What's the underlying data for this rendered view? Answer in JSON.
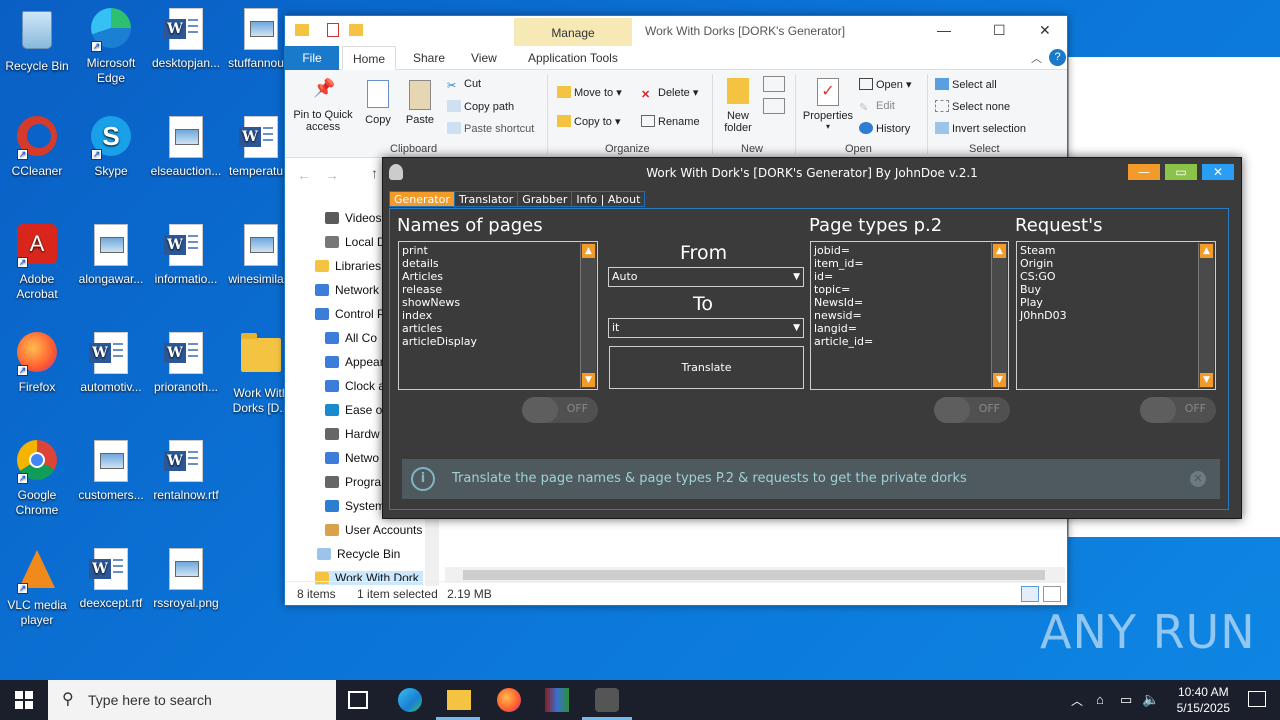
{
  "desktop": {
    "icons": [
      {
        "label": "Recycle Bin",
        "type": "recycle"
      },
      {
        "label": "Microsoft Edge",
        "type": "edge"
      },
      {
        "label": "desktopjan...",
        "type": "word"
      },
      {
        "label": "stuffannou...",
        "type": "image"
      },
      {
        "label": "CCleaner",
        "type": "ccleaner"
      },
      {
        "label": "Skype",
        "type": "skype"
      },
      {
        "label": "elseauction...",
        "type": "image"
      },
      {
        "label": "temperatu...",
        "type": "word"
      },
      {
        "label": "Adobe Acrobat",
        "type": "acrobat"
      },
      {
        "label": "alongawar...",
        "type": "image"
      },
      {
        "label": "informatio...",
        "type": "word"
      },
      {
        "label": "winesimila...",
        "type": "image"
      },
      {
        "label": "Firefox",
        "type": "firefox"
      },
      {
        "label": "automotiv...",
        "type": "word"
      },
      {
        "label": "prioranoth...",
        "type": "word"
      },
      {
        "label": "Work With Dorks [D...",
        "type": "folder"
      },
      {
        "label": "Google Chrome",
        "type": "chrome"
      },
      {
        "label": "customers...",
        "type": "image"
      },
      {
        "label": "rentalnow.rtf",
        "type": "word"
      },
      {
        "label": "VLC media player",
        "type": "vlc"
      },
      {
        "label": "deexcept.rtf",
        "type": "word"
      },
      {
        "label": "rssroyal.png",
        "type": "image"
      }
    ]
  },
  "explorer": {
    "manage_label": "Manage",
    "title": "Work With Dorks [DORK's Generator]",
    "tabs": {
      "file": "File",
      "home": "Home",
      "share": "Share",
      "view": "View",
      "app_tools": "Application Tools"
    },
    "ribbon": {
      "pin": "Pin to Quick access",
      "copy": "Copy",
      "paste": "Paste",
      "cut": "Cut",
      "copy_path": "Copy path",
      "paste_shortcut": "Paste shortcut",
      "clipboard": "Clipboard",
      "move_to": "Move to",
      "copy_to": "Copy to",
      "delete": "Delete",
      "rename": "Rename",
      "organize": "Organize",
      "new_folder": "New folder",
      "new": "New",
      "properties": "Properties",
      "open_btn": "Open",
      "edit": "Edit",
      "history": "History",
      "open_grp": "Open",
      "select_all": "Select all",
      "select_none": "Select none",
      "invert": "Invert selection",
      "select": "Select"
    },
    "nav": [
      "Videos",
      "Local D",
      "Libraries",
      "Network",
      "Control P",
      "All Co",
      "Appear",
      "Clock a",
      "Ease of",
      "Hardw",
      "Netwo",
      "Progra",
      "System",
      "User Accounts",
      "Recycle Bin",
      "Work With Dork"
    ],
    "status": {
      "items": "8 items",
      "selected": "1 item selected",
      "size": "2.19 MB"
    }
  },
  "app": {
    "title": "Work With Dork's [DORK's Generator] By JohnDoe v.2.1",
    "tabs": [
      "Generator",
      "Translator",
      "Grabber",
      "Info | About"
    ],
    "names_header": "Names of pages",
    "names": [
      "print",
      "details",
      "Articles",
      "release",
      "showNews",
      "index",
      "articles",
      "articleDisplay"
    ],
    "from_label": "From",
    "from_value": "Auto",
    "to_label": "To",
    "to_value": "it",
    "translate_label": "Translate",
    "types_header": "Page types p.2",
    "types": [
      "jobid=",
      "item_id=",
      "id=",
      "topic=",
      "NewsId=",
      "newsid=",
      "langid=",
      "article_id="
    ],
    "requests_header": "Request's",
    "requests": [
      "Steam",
      "Origin",
      "CS:GO",
      "Buy",
      "Play",
      "J0hnD03"
    ],
    "toggle_text": "OFF",
    "info_text": "Translate the page names & page types P.2 & requests to get the private dorks"
  },
  "taskbar": {
    "search_placeholder": "Type here to search",
    "time": "10:40 AM",
    "date": "5/15/2025"
  },
  "watermark": "ANY RUN"
}
